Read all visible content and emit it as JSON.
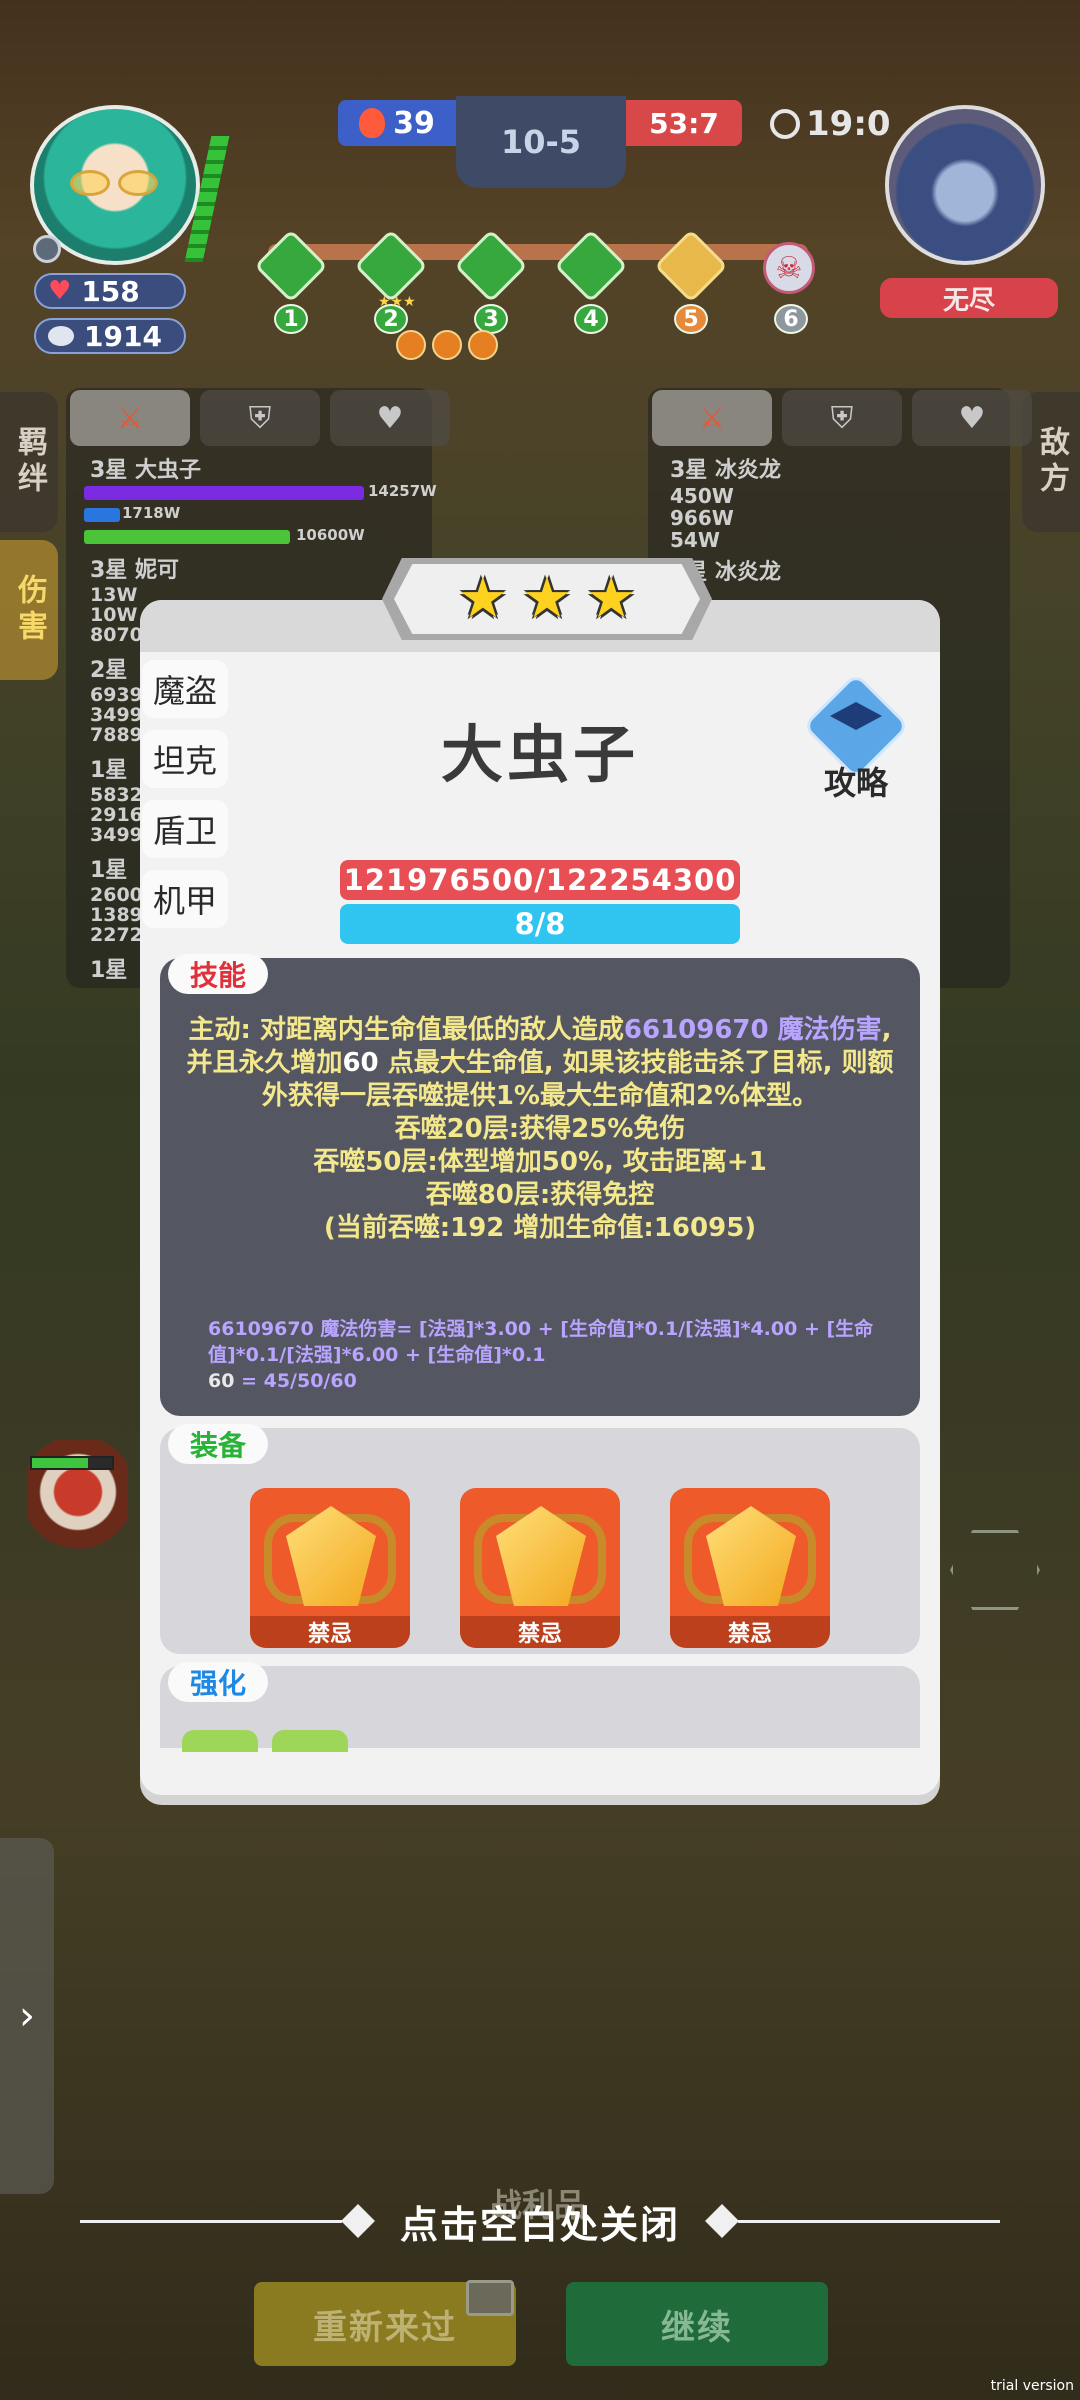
{
  "hud": {
    "left_score": "39",
    "stage": "10-5",
    "right_score": "53:7",
    "timer": "19:0",
    "hp": "158",
    "coins": "1914",
    "boss_label": "无尽",
    "nodes": [
      "1",
      "2",
      "3",
      "4",
      "5",
      "6"
    ]
  },
  "side_tabs": {
    "left": [
      {
        "label": "羁绊",
        "active": false
      },
      {
        "label": "伤害",
        "active": true
      }
    ],
    "right": [
      {
        "label": "敌方",
        "active": false
      }
    ]
  },
  "background_panel": {
    "left": {
      "hero_1": "3星 大虫子",
      "bar_1_value": "14257W",
      "bar_2_value": "1718W",
      "bar_3_value": "10600W",
      "hero_2": "3星 妮可",
      "values_2": [
        "13W",
        "10W",
        "8070"
      ],
      "hero_3": "2星",
      "values_3": [
        "6939",
        "3499",
        "7889"
      ],
      "hero_4": "1星",
      "values_4": [
        "5832",
        "2916",
        "3499"
      ],
      "hero_5": "1星",
      "values_5": [
        "2600",
        "1389",
        "2272"
      ],
      "hero_6": "1星"
    },
    "right": {
      "hero_1": "3星 冰炎龙",
      "values_1": [
        "450W",
        "966W",
        "54W"
      ],
      "hero_2": "3星 冰炎龙"
    }
  },
  "modal": {
    "stars": 3,
    "class_tabs": [
      "魔盗",
      "坦克",
      "盾卫",
      "机甲"
    ],
    "hero_name": "大虫子",
    "guide_label": "攻略",
    "hp_text": "121976500/122254300",
    "energy_text": "8/8",
    "skill": {
      "label": "技能",
      "prefix": "主动: 对距离内生命值最低的敌人造成",
      "damage": "66109670 魔法伤害",
      "text_1": ", 并且永久增加",
      "hp_gain": "60",
      "text_2": " 点最大生命值, 如果该技能击杀了目标, 则额外获得一层吞噬提供1%最大生命值和2%体型。",
      "line_20": "吞噬20层:获得25%免伤",
      "line_50": "吞噬50层:体型增加50%, 攻击距离+1",
      "line_80": "吞噬80层:获得免控",
      "line_current": "(当前吞噬:192 增加生命值:16095)",
      "formula_1_head": "66109670 魔法伤害",
      "formula_1_body": "= [法强]*3.00 + [生命值]*0.1/[法强]*4.00 + [生命值]*0.1/[法强]*6.00 + [生命值]*0.1",
      "formula_2_head": "60",
      "formula_2_body": " = 45/50/60"
    },
    "equipment": {
      "label": "装备",
      "items": [
        {
          "name": "禁忌",
          "icon": "gem-chain-icon"
        },
        {
          "name": "禁忌",
          "icon": "gem-chain-icon"
        },
        {
          "name": "禁忌",
          "icon": "gem-chain-icon"
        }
      ]
    },
    "enhance": {
      "label": "强化"
    }
  },
  "footer": {
    "close_hint": "点击空白处关闭",
    "loot_label": "战利品",
    "retry_label": "重新来过",
    "continue_label": "继续",
    "watermark": "trial version"
  },
  "colors": {
    "hp_bar": "#e84f55",
    "energy_bar": "#2fc5f0",
    "skill_bg": "#545662",
    "skill_text": "#f4e88c",
    "highlight": "#b9a4ff"
  }
}
